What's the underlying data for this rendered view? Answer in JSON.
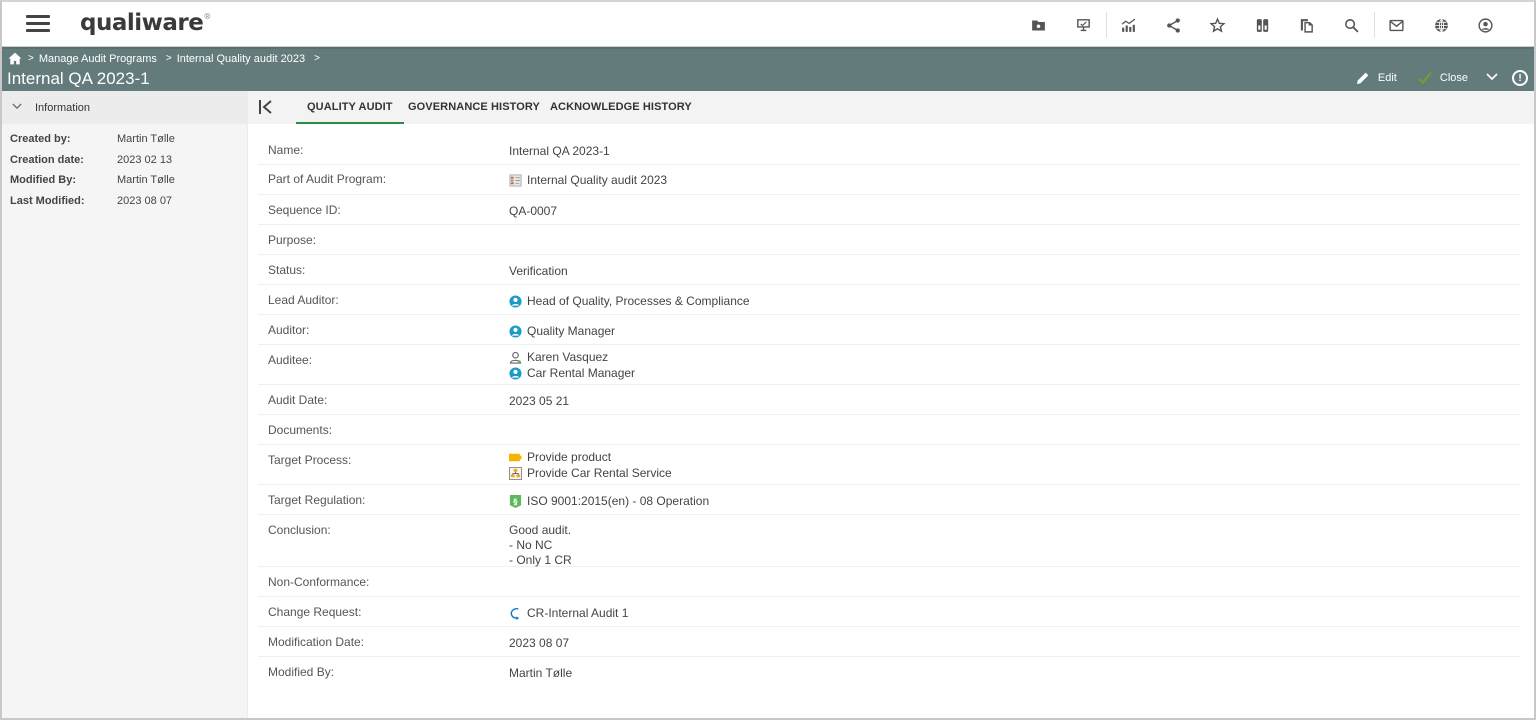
{
  "app": {
    "logo": "qualiware",
    "logo_mark": "®"
  },
  "toolbar": {
    "icons": [
      "folder-icon",
      "presentation-icon",
      "chart-icon",
      "share-icon",
      "star-icon",
      "compare-icon",
      "copy-icon",
      "search-icon",
      "mail-icon",
      "globe-icon",
      "account-icon"
    ]
  },
  "breadcrumb": {
    "items": [
      "Manage Audit Programs",
      "Internal Quality audit 2023"
    ],
    "separator": ">"
  },
  "page": {
    "title": "Internal QA 2023-1"
  },
  "actions": {
    "edit_label": "Edit",
    "close_label": "Close",
    "info_label": "!"
  },
  "colors": {
    "titlebar": "#647b7b",
    "tab_active_underline": "#2e8b47",
    "close_check": "#6aa52e",
    "role_icon": "#1b9bc9"
  },
  "info_panel": {
    "header": "Information",
    "rows": [
      {
        "label": "Created by:",
        "value": "Martin Tølle"
      },
      {
        "label": "Creation date:",
        "value": "2023 02 13"
      },
      {
        "label": "Modified By:",
        "value": "Martin Tølle"
      },
      {
        "label": "Last Modified:",
        "value": "2023 08 07"
      }
    ]
  },
  "tabs": [
    {
      "label": "QUALITY AUDIT",
      "active": true
    },
    {
      "label": "GOVERNANCE HISTORY",
      "active": false
    },
    {
      "label": "ACKNOWLEDGE HISTORY",
      "active": false
    }
  ],
  "fields": {
    "name": {
      "label": "Name:",
      "value": "Internal QA 2023-1"
    },
    "audit_program": {
      "label": "Part of Audit Program:",
      "value": "Internal Quality audit 2023",
      "icon": "audit-program-icon"
    },
    "sequence_id": {
      "label": "Sequence ID:",
      "value": "QA-0007"
    },
    "purpose": {
      "label": "Purpose:",
      "value": ""
    },
    "status": {
      "label": "Status:",
      "value": "Verification"
    },
    "lead_auditor": {
      "label": "Lead Auditor:",
      "value": "Head of Quality, Processes & Compliance",
      "icon": "role-icon"
    },
    "auditor": {
      "label": "Auditor:",
      "value": "Quality Manager",
      "icon": "role-icon"
    },
    "auditee": {
      "label": "Auditee:",
      "values": [
        {
          "text": "Karen Vasquez",
          "icon": "person-icon"
        },
        {
          "text": "Car Rental Manager",
          "icon": "role-icon"
        }
      ]
    },
    "audit_date": {
      "label": "Audit Date:",
      "value": "2023 05 21"
    },
    "documents": {
      "label": "Documents:",
      "value": ""
    },
    "target_process": {
      "label": "Target Process:",
      "values": [
        {
          "text": "Provide product",
          "icon": "process-icon"
        },
        {
          "text": "Provide Car Rental Service",
          "icon": "process-diagram-icon"
        }
      ]
    },
    "target_regulation": {
      "label": "Target Regulation:",
      "value": "ISO 9001:2015(en) - 08 Operation",
      "icon": "regulation-icon"
    },
    "conclusion": {
      "label": "Conclusion:",
      "lines": [
        "Good audit.",
        "- No NC",
        "- Only 1 CR"
      ]
    },
    "non_conformance": {
      "label": "Non-Conformance:",
      "value": ""
    },
    "change_request": {
      "label": "Change Request:",
      "value": "CR-Internal Audit 1",
      "icon": "change-request-icon"
    },
    "modification_date": {
      "label": "Modification Date:",
      "value": "2023 08 07"
    },
    "modified_by": {
      "label": "Modified By:",
      "value": "Martin Tølle"
    }
  }
}
